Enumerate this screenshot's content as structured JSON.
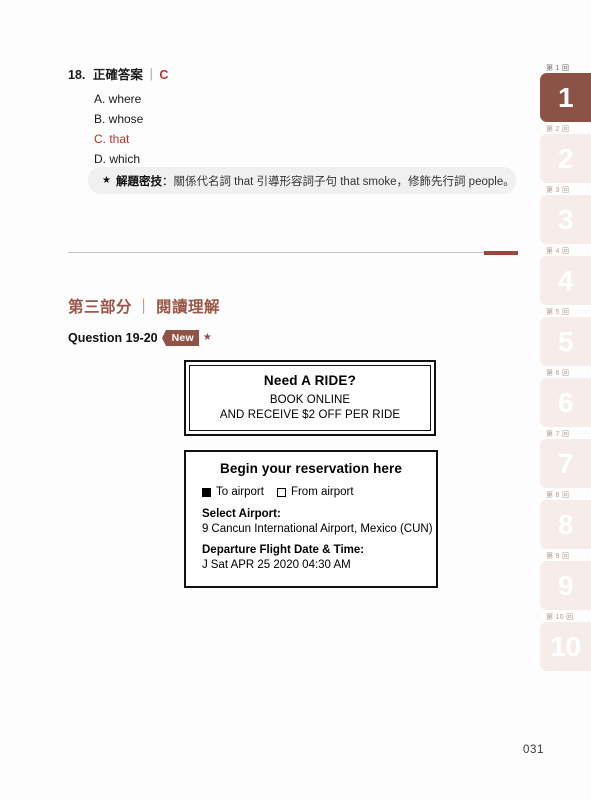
{
  "page": {
    "number": "031"
  },
  "question18": {
    "number": "18.",
    "answer_label": "正確答案",
    "separator": "｜",
    "answer": "C",
    "options": [
      {
        "text": "A. where",
        "correct": false
      },
      {
        "text": "B. whose",
        "correct": false
      },
      {
        "text": "C. that",
        "correct": true
      },
      {
        "text": "D. which",
        "correct": false
      }
    ]
  },
  "tip": {
    "star": "★",
    "title": "解題密技",
    "colon": "：",
    "text": "關係代名詞 that 引導形容詞子句 that smoke，修飾先行詞 people。"
  },
  "part_heading": {
    "part": "第三部分",
    "separator": "｜",
    "title": "閱讀理解"
  },
  "question_line": {
    "range": "Question 19-20",
    "badge": "New",
    "badge_star": "★"
  },
  "ad_box": {
    "title": "Need A RIDE?",
    "line1": "BOOK ONLINE",
    "line2": "AND RECEIVE $2 OFF PER RIDE"
  },
  "form_box": {
    "title": "Begin your reservation here",
    "option_to": "To airport",
    "option_from": "From airport",
    "airport_label": "Select Airport:",
    "airport_marker": "9",
    "airport_value": "Cancun International Airport, Mexico (CUN)",
    "datetime_label": "Departure Flight Date & Time:",
    "datetime_marker": "J",
    "datetime_value": "Sat APR 25 2020 04:30 AM"
  },
  "tabs": [
    {
      "label": "第 1 回",
      "number": "1",
      "active": true
    },
    {
      "label": "第 2 回",
      "number": "2",
      "active": false
    },
    {
      "label": "第 3 回",
      "number": "3",
      "active": false
    },
    {
      "label": "第 4 回",
      "number": "4",
      "active": false
    },
    {
      "label": "第 5 回",
      "number": "5",
      "active": false
    },
    {
      "label": "第 6 回",
      "number": "6",
      "active": false
    },
    {
      "label": "第 7 回",
      "number": "7",
      "active": false
    },
    {
      "label": "第 8 回",
      "number": "8",
      "active": false
    },
    {
      "label": "第 9 回",
      "number": "9",
      "active": false
    },
    {
      "label": "第 10 回",
      "number": "10",
      "active": false
    }
  ],
  "colors": {
    "accent_brown": "#8d5246",
    "accent_heading": "#9b5847",
    "answer_red": "#b4352e",
    "tab_inactive": "#f6ecea",
    "divider": "#c9c2c0",
    "divider_accent": "#9a4638"
  }
}
